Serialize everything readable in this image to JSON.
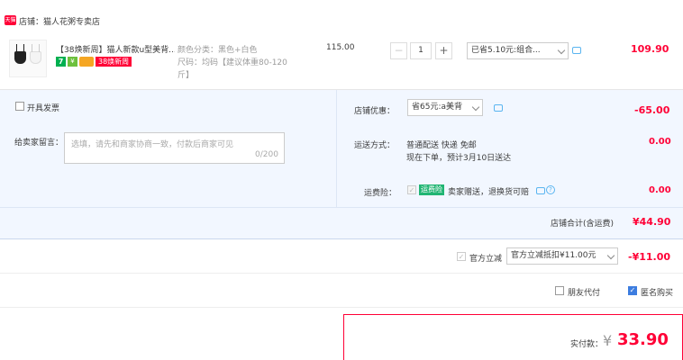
{
  "shop": {
    "icon_label": "天猫",
    "name": "店铺：猫人花粥专卖店"
  },
  "item": {
    "title": "【38焕新周】猫人新款u型美背...",
    "badge_7": "7",
    "badge_y": "¥",
    "badge_38": "38焕新周",
    "sku_color": "颜色分类：黑色+白色",
    "sku_size": "尺码：均码【建议体重80-120斤】",
    "unit_price": "115.00",
    "qty_minus": "−",
    "quantity": "1",
    "qty_plus": "+",
    "promo": "已省5.10元:组合...",
    "total": "109.90"
  },
  "options": {
    "invoice_label": "开具发票",
    "memo_label": "给卖家留言：",
    "memo_placeholder": "选填，请先和商家协商一致，付款后商家可见",
    "memo_count": "0/200",
    "shop_discount_label": "店铺优惠：",
    "shop_discount_select": "省65元:a美背",
    "shop_discount_value": "-65.00",
    "shipping_label": "运送方式：",
    "shipping_line1": "普通配送 快递 免邮",
    "shipping_line2": "现在下单，预计3月10日送达",
    "shipping_value": "0.00",
    "insurance_label": "运费险：",
    "insurance_check": "✓",
    "insurance_tag": "运费险",
    "insurance_text": "卖家赠送，退换货可赔",
    "insurance_help": "?",
    "insurance_value": "0.00"
  },
  "shop_total": {
    "label": "店铺合计(含运费)",
    "value": "¥44.90"
  },
  "platform": {
    "check": "✓",
    "label": "官方立减",
    "select": "官方立减抵扣¥11.00元",
    "value": "-¥11.00"
  },
  "extras": {
    "friend_label": "朋友代付",
    "anon_check": "✓",
    "anon_label": "匿名购买"
  },
  "payment": {
    "label": "实付款：",
    "currency": "¥",
    "value": "33.90"
  }
}
